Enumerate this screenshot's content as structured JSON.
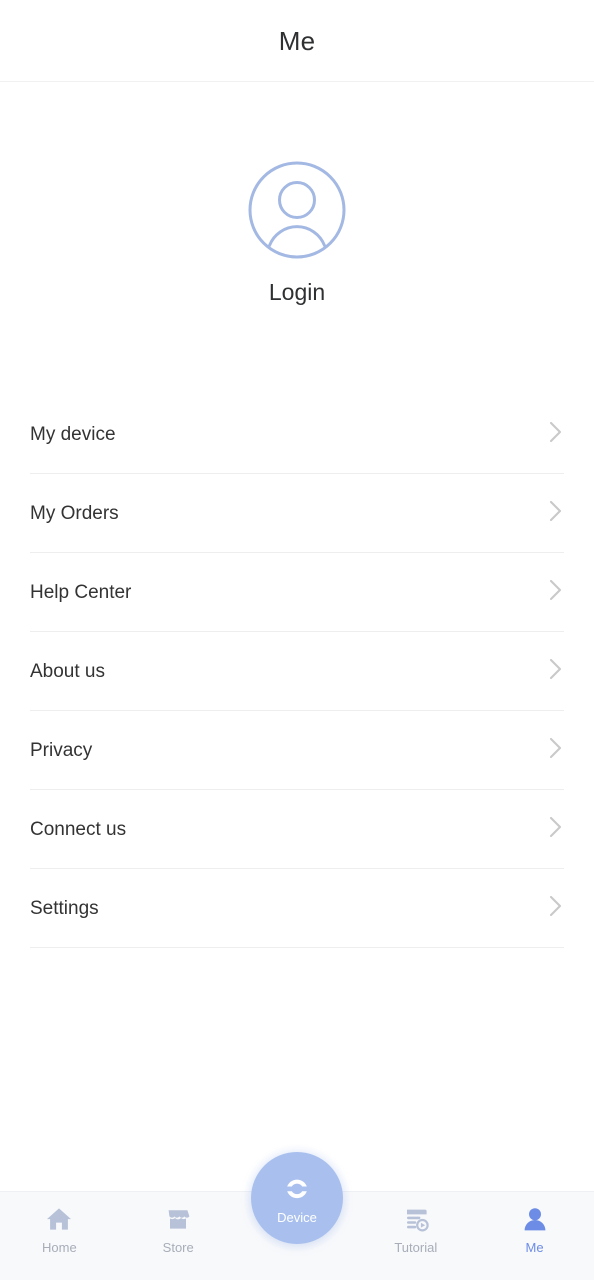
{
  "header": {
    "title": "Me"
  },
  "profile": {
    "avatar_icon": "user-avatar-icon",
    "login_label": "Login",
    "avatar_color": "#a3b8e3"
  },
  "menu": {
    "chevron_icon": "chevron-right-icon",
    "items": [
      {
        "label": "My device"
      },
      {
        "label": "My Orders"
      },
      {
        "label": "Help Center"
      },
      {
        "label": "About us"
      },
      {
        "label": "Privacy"
      },
      {
        "label": "Connect us"
      },
      {
        "label": "Settings"
      }
    ]
  },
  "tabbar": {
    "active_color": "#6c8ce6",
    "inactive_color": "#a8adb8",
    "icon_color": "#b7c2d8",
    "center_bg": "#a9c0ee",
    "tabs": [
      {
        "label": "Home",
        "icon": "home-icon",
        "active": false
      },
      {
        "label": "Store",
        "icon": "store-icon",
        "active": false
      },
      {
        "label": "Device",
        "icon": "sync-icon",
        "active": false,
        "center": true
      },
      {
        "label": "Tutorial",
        "icon": "tutorial-icon",
        "active": false
      },
      {
        "label": "Me",
        "icon": "person-icon",
        "active": true
      }
    ]
  }
}
